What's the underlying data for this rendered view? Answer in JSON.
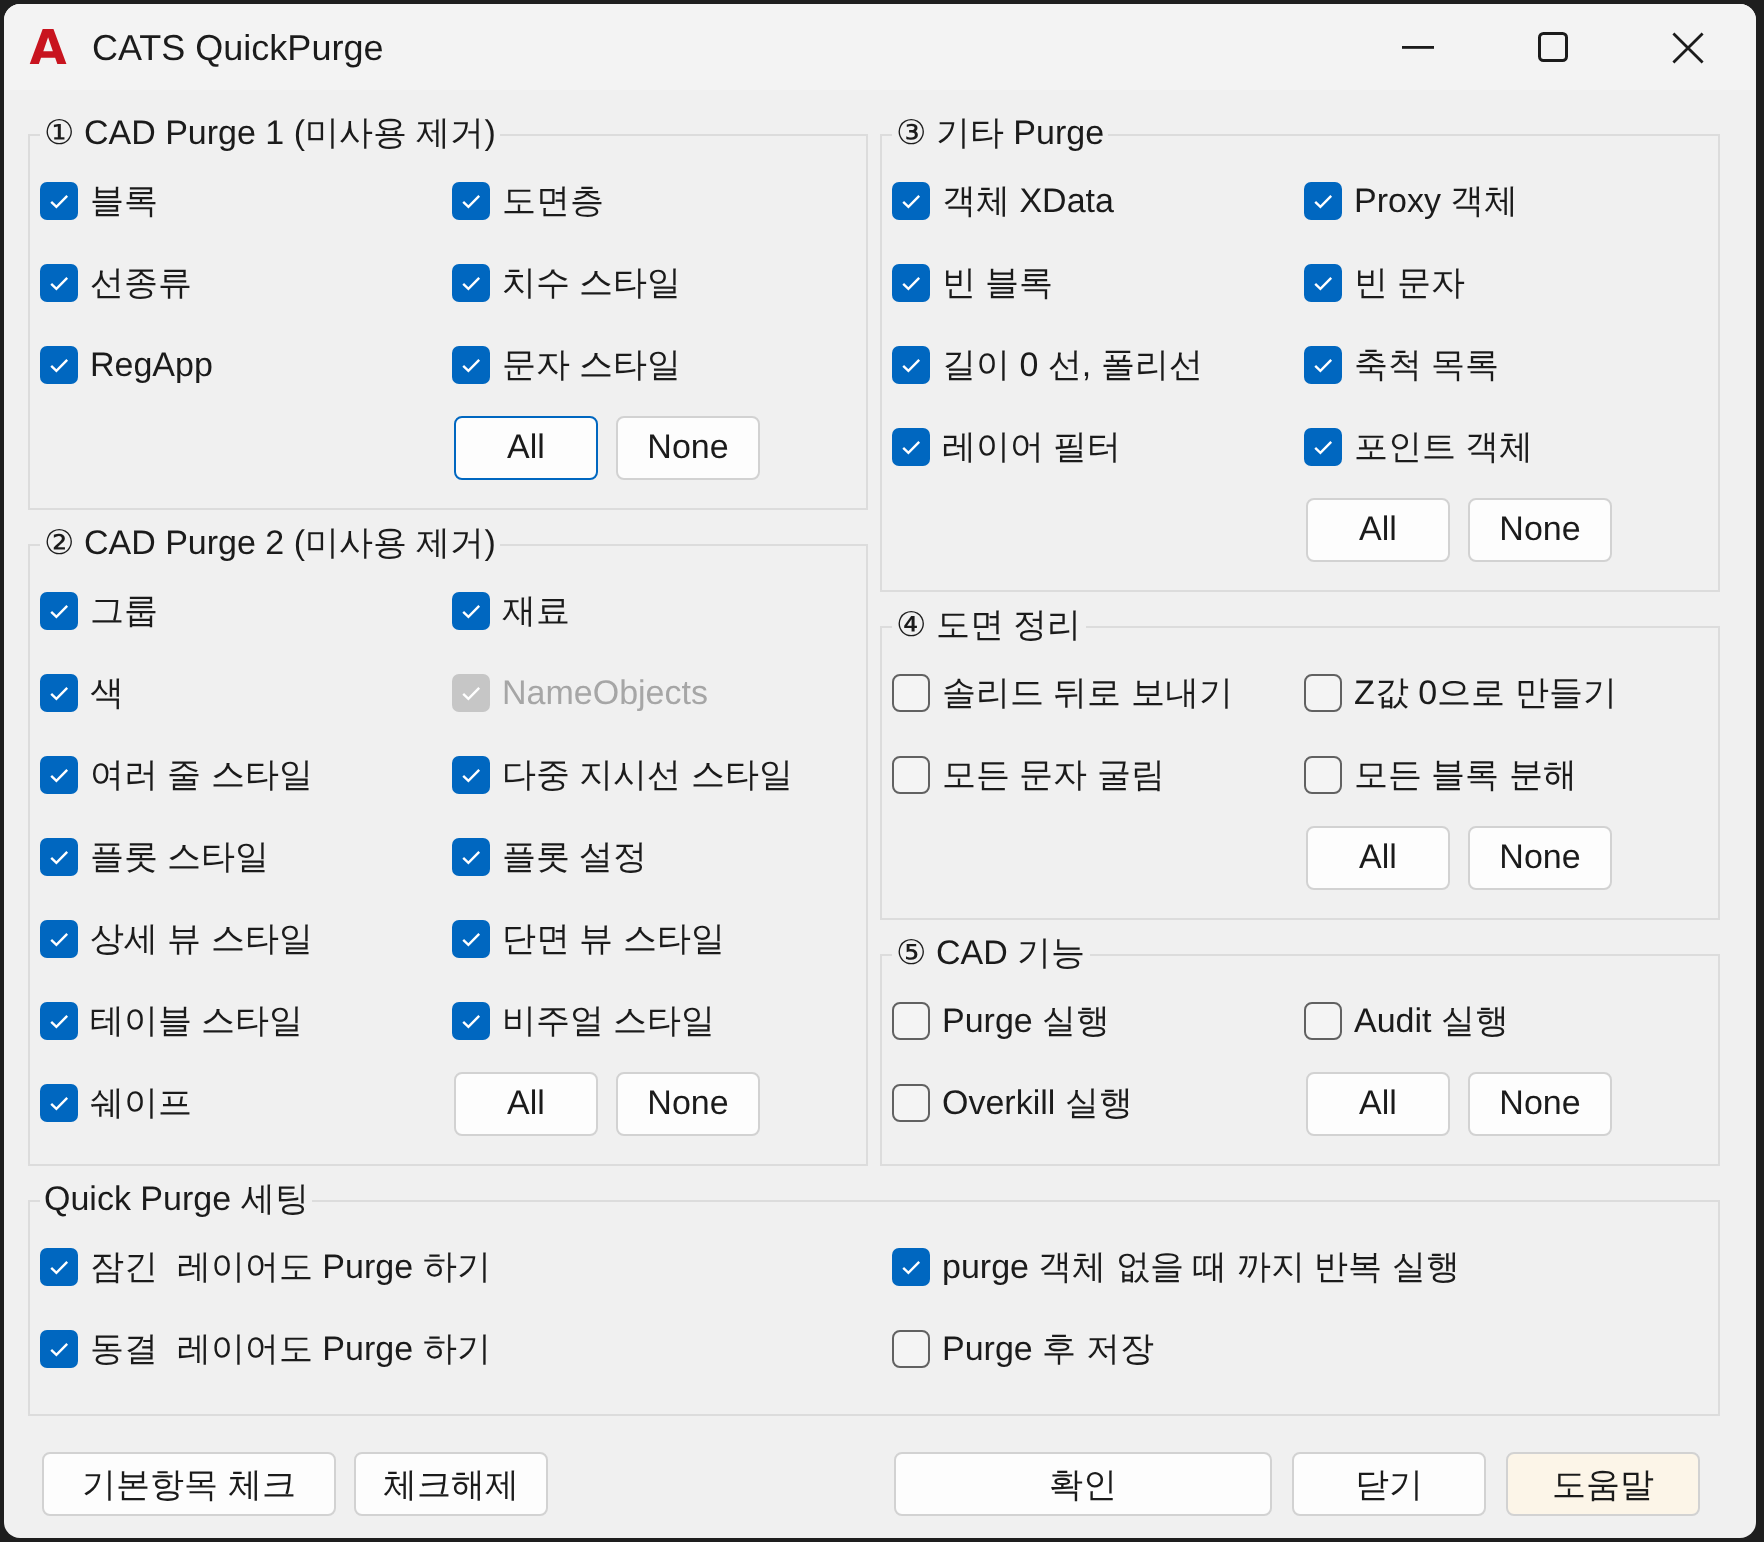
{
  "window": {
    "logo": "A",
    "title": "CATS QuickPurge"
  },
  "columns": [
    {
      "groups": [
        {
          "title": "① CAD Purge 1 (미사용 제거)",
          "options": [
            {
              "label": "블록",
              "checked": true,
              "disabled": false
            },
            {
              "label": "도면층",
              "checked": true,
              "disabled": false
            },
            {
              "label": "선종류",
              "checked": true,
              "disabled": false
            },
            {
              "label": "치수 스타일",
              "checked": true,
              "disabled": false
            },
            {
              "label": "RegApp",
              "checked": true,
              "disabled": false
            },
            {
              "label": "문자 스타일",
              "checked": true,
              "disabled": false
            }
          ],
          "buttons": [
            {
              "label": "All",
              "focused": true
            },
            {
              "label": "None",
              "focused": false
            }
          ]
        },
        {
          "title": "② CAD Purge 2 (미사용 제거)",
          "options": [
            {
              "label": "그룹",
              "checked": true,
              "disabled": false
            },
            {
              "label": "재료",
              "checked": true,
              "disabled": false
            },
            {
              "label": "색",
              "checked": true,
              "disabled": false
            },
            {
              "label": "NameObjects",
              "checked": true,
              "disabled": true
            },
            {
              "label": "여러 줄 스타일",
              "checked": true,
              "disabled": false
            },
            {
              "label": "다중 지시선 스타일",
              "checked": true,
              "disabled": false
            },
            {
              "label": "플롯 스타일",
              "checked": true,
              "disabled": false
            },
            {
              "label": "플롯 설정",
              "checked": true,
              "disabled": false
            },
            {
              "label": "상세 뷰 스타일",
              "checked": true,
              "disabled": false
            },
            {
              "label": "단면 뷰 스타일",
              "checked": true,
              "disabled": false
            },
            {
              "label": "테이블 스타일",
              "checked": true,
              "disabled": false
            },
            {
              "label": "비주얼 스타일",
              "checked": true,
              "disabled": false
            },
            {
              "label": "쉐이프",
              "checked": true,
              "disabled": false
            }
          ],
          "buttons": [
            {
              "label": "All",
              "focused": false
            },
            {
              "label": "None",
              "focused": false
            }
          ]
        }
      ]
    },
    {
      "groups": [
        {
          "title": "③ 기타 Purge",
          "options": [
            {
              "label": "객체 XData",
              "checked": true,
              "disabled": false
            },
            {
              "label": "Proxy 객체",
              "checked": true,
              "disabled": false
            },
            {
              "label": "빈 블록",
              "checked": true,
              "disabled": false
            },
            {
              "label": "빈 문자",
              "checked": true,
              "disabled": false
            },
            {
              "label": "길이 0 선, 폴리선",
              "checked": true,
              "disabled": false
            },
            {
              "label": "축척 목록",
              "checked": true,
              "disabled": false
            },
            {
              "label": "레이어 필터",
              "checked": true,
              "disabled": false
            },
            {
              "label": "포인트 객체",
              "checked": true,
              "disabled": false
            }
          ],
          "buttons": [
            {
              "label": "All",
              "focused": false
            },
            {
              "label": "None",
              "focused": false
            }
          ]
        },
        {
          "title": "④ 도면 정리",
          "options": [
            {
              "label": "솔리드 뒤로 보내기",
              "checked": false,
              "disabled": false
            },
            {
              "label": "Z값 0으로 만들기",
              "checked": false,
              "disabled": false
            },
            {
              "label": "모든 문자 굴림",
              "checked": false,
              "disabled": false
            },
            {
              "label": "모든 블록 분해",
              "checked": false,
              "disabled": false
            }
          ],
          "buttons": [
            {
              "label": "All",
              "focused": false
            },
            {
              "label": "None",
              "focused": false
            }
          ]
        },
        {
          "title": "⑤ CAD 기능",
          "options": [
            {
              "label": "Purge 실행",
              "checked": false,
              "disabled": false
            },
            {
              "label": "Audit 실행",
              "checked": false,
              "disabled": false
            },
            {
              "label": "Overkill 실행",
              "checked": false,
              "disabled": false
            }
          ],
          "buttons": [
            {
              "label": "All",
              "focused": false
            },
            {
              "label": "None",
              "focused": false
            }
          ]
        }
      ]
    }
  ],
  "settings": {
    "title": "Quick Purge 세팅",
    "options": [
      {
        "label": "잠긴  레이어도 Purge 하기",
        "checked": true,
        "disabled": false
      },
      {
        "label": "purge 객체 없을 때 까지 반복 실행",
        "checked": true,
        "disabled": false
      },
      {
        "label": "동결  레이어도 Purge 하기",
        "checked": true,
        "disabled": false
      },
      {
        "label": "Purge 후 저장",
        "checked": false,
        "disabled": false
      }
    ]
  },
  "footer": {
    "left": [
      {
        "label": "기본항목 체크",
        "highlighted": false
      },
      {
        "label": "체크해제",
        "highlighted": false
      }
    ],
    "right": [
      {
        "label": "확인",
        "highlighted": false
      },
      {
        "label": "닫기",
        "highlighted": false
      },
      {
        "label": "도움말",
        "highlighted": true
      }
    ]
  }
}
